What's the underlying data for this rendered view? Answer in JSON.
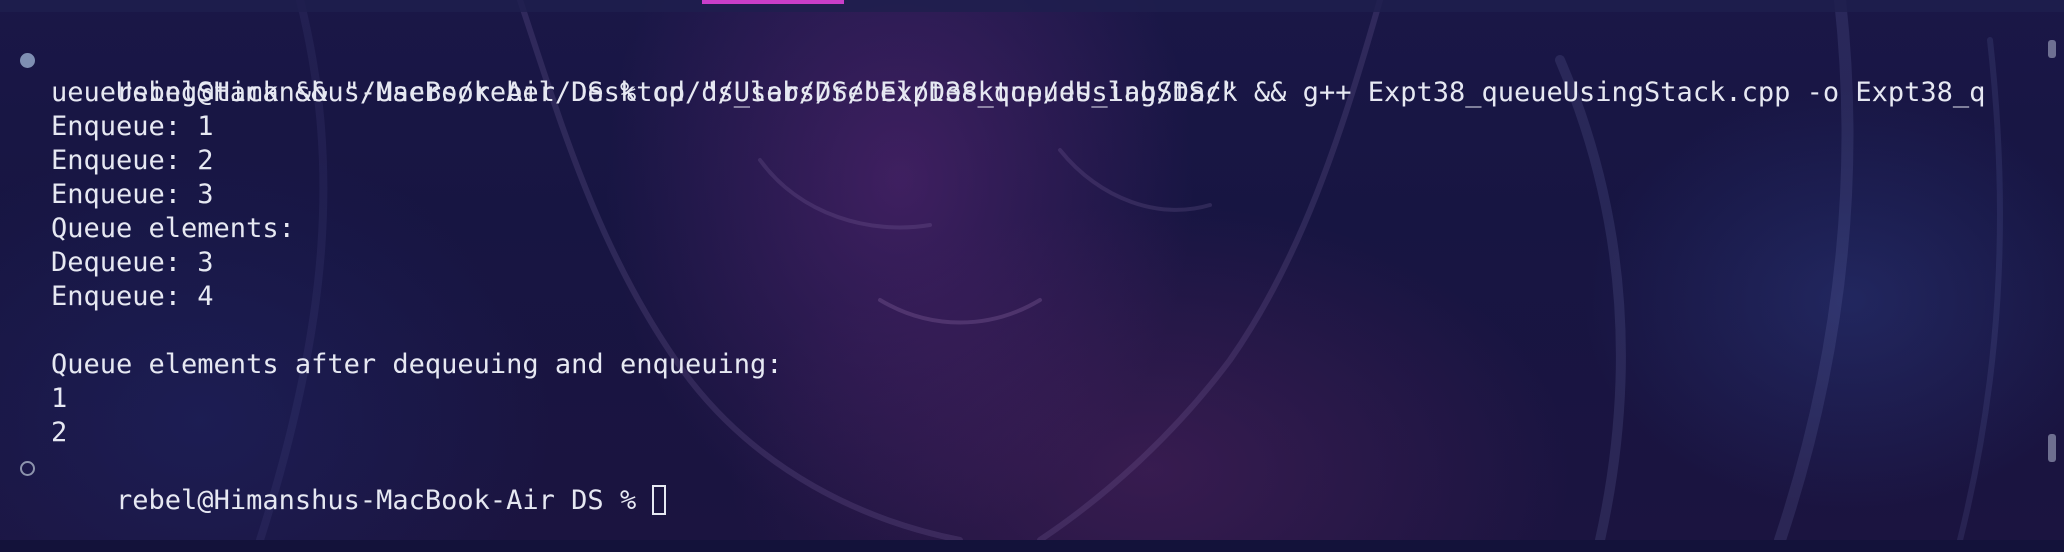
{
  "terminal": {
    "command_prompt": "rebel@Himanshus-MacBook-Air DS % ",
    "command_line_1": "cd \"/Users/rebel/Desktop/ds_lab/DS/\" && g++ Expt38_queueUsingStack.cpp -o Expt38_q",
    "command_line_2": "ueueUsingStack && \"/Users/rebel/Desktop/ds_lab/DS/\"Expt38_queueUsingStack",
    "output": [
      "Enqueue: 1",
      "Enqueue: 2",
      "Enqueue: 3",
      "Queue elements:",
      "Dequeue: 3",
      "Enqueue: 4",
      "",
      "Queue elements after dequeuing and enqueuing:",
      "1",
      "2"
    ],
    "current_prompt": "rebel@Himanshus-MacBook-Air DS % "
  },
  "colors": {
    "background": "#171542",
    "text": "#e6e8f2",
    "tab_indicator": "#c93ec9",
    "success_dot": "#7f8fb3"
  },
  "icons": {
    "command_status": "filled-circle",
    "current_prompt_status": "hollow-circle",
    "cursor": "block-cursor"
  }
}
